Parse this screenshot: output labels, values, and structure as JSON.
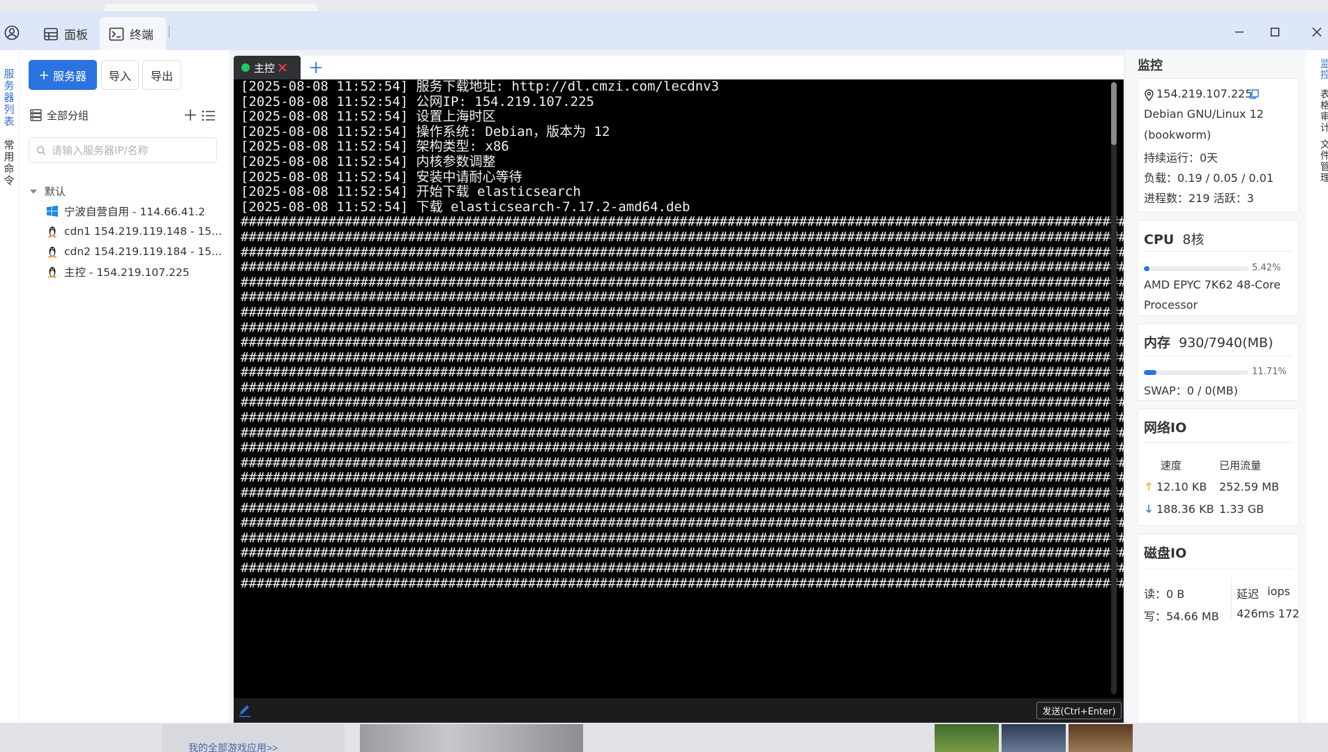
{
  "title_bar": {
    "tabs": [
      {
        "label": "面板",
        "icon": "panel-icon"
      },
      {
        "label": "终端",
        "icon": "terminal-icon"
      }
    ],
    "window_controls": [
      "minimize-icon",
      "maximize-icon",
      "close-icon"
    ]
  },
  "left_rail": {
    "servers_label": "服务器列表",
    "commands_label": "常用命令"
  },
  "sidebar": {
    "add_server_label": "服务器",
    "import_label": "导入",
    "export_label": "导出",
    "group_label": "全部分组",
    "search_placeholder": "请输入服务器IP/名称",
    "group_default": "默认",
    "servers": [
      {
        "name": "宁波自营自用 - 114.66.41.2",
        "os": "windows-icon"
      },
      {
        "name": "cdn1 154.219.119.148 - 15...",
        "os": "linux-icon"
      },
      {
        "name": "cdn2 154.219.119.184 - 15...",
        "os": "linux-icon"
      },
      {
        "name": "主控 - 154.219.107.225",
        "os": "linux-icon"
      }
    ]
  },
  "terminal": {
    "tab_label": "主控",
    "send_label": "发送(Ctrl+Enter)",
    "lines": [
      "[2025-08-08 11:52:54] 服务下载地址: http://dl.cmzi.com/lecdnv3",
      "[2025-08-08 11:52:54] 公网IP: 154.219.107.225",
      "[2025-08-08 11:52:54] 设置上海时区",
      "[2025-08-08 11:52:54] 操作系统: Debian，版本为 12",
      "[2025-08-08 11:52:54] 架构类型: x86",
      "[2025-08-08 11:52:54] 内核参数调整",
      "[2025-08-08 11:52:54] 安装中请耐心等待",
      "[2025-08-08 11:52:54] 开始下载 elasticsearch",
      "[2025-08-08 11:52:54] 下载 elasticsearch-7.17.2-amd64.deb"
    ],
    "progress_line": "########################################################################################################################",
    "progress_line_count": 25
  },
  "monitor": {
    "title": "监控",
    "ip": "154.219.107.225",
    "os_line1": "Debian GNU/Linux 12",
    "os_line2": "(bookworm)",
    "uptime": "持续运行：0天",
    "load": "负载：0.19 / 0.05 / 0.01",
    "processes": "进程数：219   活跃：3",
    "cpu": {
      "label": "CPU",
      "cores": "8核",
      "percent_text": "5.42%",
      "percent": 5.42,
      "model_line1": "AMD EPYC 7K62 48-Core",
      "model_line2": "Processor"
    },
    "memory": {
      "label": "内存",
      "value": "930/7940(MB)",
      "percent_text": "11.71%",
      "percent": 11.71,
      "swap": "SWAP：0 / 0(MB)"
    },
    "network": {
      "label": "网络IO",
      "col_speed": "速度",
      "col_used": "已用流量",
      "up_speed": "12.10 KB",
      "up_used": "252.59 MB",
      "down_speed": "188.36 KB",
      "down_used": "1.33 GB"
    },
    "disk": {
      "label": "磁盘IO",
      "read": "读：0 B",
      "latency_label": "延迟",
      "iops_label": "iops",
      "write_partial": "写：54.66 MB",
      "latency_partial": "426ms 172"
    }
  },
  "right_rail": {
    "items": [
      "监控",
      "表格审计",
      "文件管理"
    ]
  },
  "desktop": {
    "link_text": "我的全部游戏应用>>"
  }
}
